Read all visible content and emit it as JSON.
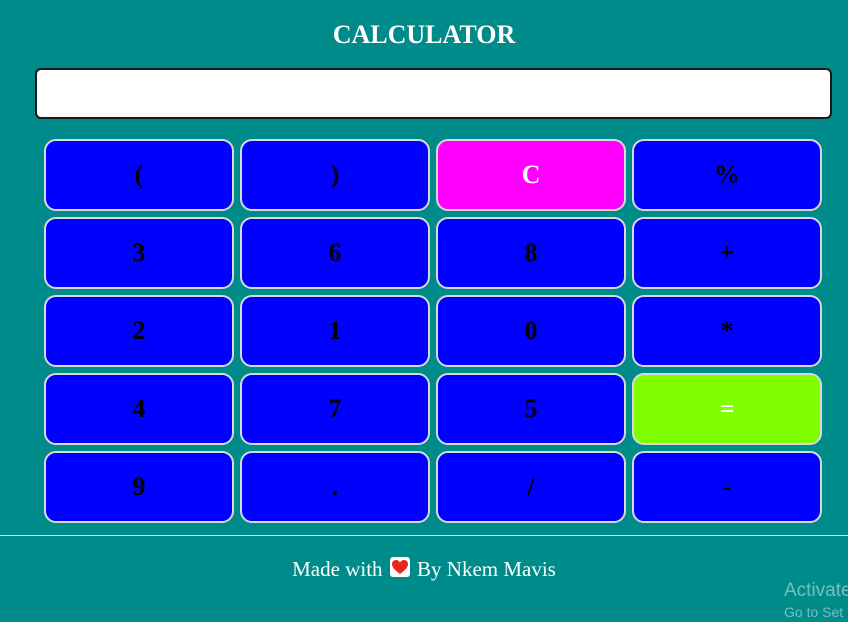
{
  "header": {
    "title": "CALCULATOR"
  },
  "display": {
    "value": ""
  },
  "keys": [
    {
      "label": "(",
      "name": "open-paren-button"
    },
    {
      "label": ")",
      "name": "close-paren-button"
    },
    {
      "label": "C",
      "name": "clear-button"
    },
    {
      "label": "%",
      "name": "percent-button"
    },
    {
      "label": "3",
      "name": "digit-3-button"
    },
    {
      "label": "6",
      "name": "digit-6-button"
    },
    {
      "label": "8",
      "name": "digit-8-button"
    },
    {
      "label": "+",
      "name": "add-button"
    },
    {
      "label": "2",
      "name": "digit-2-button"
    },
    {
      "label": "1",
      "name": "digit-1-button"
    },
    {
      "label": "0",
      "name": "digit-0-button"
    },
    {
      "label": "*",
      "name": "multiply-button"
    },
    {
      "label": "4",
      "name": "digit-4-button"
    },
    {
      "label": "7",
      "name": "digit-7-button"
    },
    {
      "label": "5",
      "name": "digit-5-button"
    },
    {
      "label": "=",
      "name": "equals-button"
    },
    {
      "label": "9",
      "name": "digit-9-button"
    },
    {
      "label": ".",
      "name": "decimal-button"
    },
    {
      "label": "/",
      "name": "divide-button"
    },
    {
      "label": "-",
      "name": "subtract-button"
    }
  ],
  "footer": {
    "prefix": "Made with",
    "icon": "heart-icon",
    "suffix": "By Nkem Mavis"
  },
  "watermark": {
    "line1": "Activate",
    "line2": "Go to Set"
  },
  "colors": {
    "background": "#008b8b",
    "key": "#0000ff",
    "clear_key": "#ff00ff",
    "equals_key": "#7fff00",
    "heart": "#e8261c"
  }
}
